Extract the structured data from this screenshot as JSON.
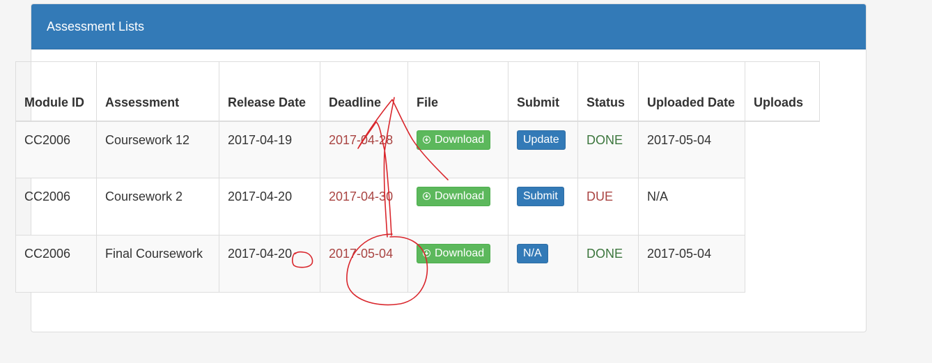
{
  "panel": {
    "title": "Assessment Lists"
  },
  "table": {
    "headers": {
      "module_id": "Module ID",
      "assessment": "Assessment",
      "release_date": "Release Date",
      "deadline": "Deadline",
      "file": "File",
      "submit": "Submit",
      "status": "Status",
      "uploaded_date": "Uploaded Date",
      "uploads": "Uploads"
    },
    "rows": [
      {
        "module_id": "CC2006",
        "assessment": "Coursework 12",
        "release_date": "2017-04-19",
        "deadline": "2017-04-28",
        "file_button": "Download",
        "submit_button": "Update",
        "status": "DONE",
        "uploaded_date": "2017-05-04"
      },
      {
        "module_id": "CC2006",
        "assessment": "Coursework 2",
        "release_date": "2017-04-20",
        "deadline": "2017-04-30",
        "file_button": "Download",
        "submit_button": "Submit",
        "status": "DUE",
        "uploaded_date": "N/A"
      },
      {
        "module_id": "CC2006",
        "assessment": "Final Coursework",
        "release_date": "2017-04-20",
        "deadline": "2017-05-04",
        "file_button": "Download",
        "submit_button": "N/A",
        "status": "DONE",
        "uploaded_date": "2017-05-04"
      }
    ]
  },
  "icons": {
    "download": "download-circle-icon"
  },
  "colors": {
    "heading_bg": "#337ab7",
    "deadline_text": "#a94442",
    "status_done": "#3c763d",
    "status_due": "#a94442",
    "download_button": "#5cb85c",
    "submit_button": "#337ab7",
    "annotation_ink": "#d9262c"
  }
}
